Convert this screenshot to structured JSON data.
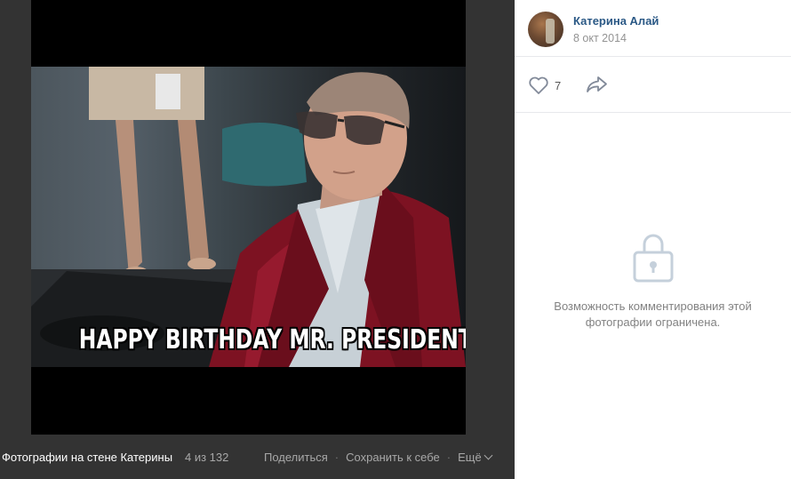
{
  "photo": {
    "caption": "HAPPY BIRTHDAY MR. PRESIDENT"
  },
  "footer": {
    "album": "Фотографии на стене Катерины",
    "counter": "4 из 132",
    "share": "Поделиться",
    "save": "Сохранить к себе",
    "more": "Ещё"
  },
  "author": {
    "name": "Катерина Алай",
    "date": "8 окт 2014"
  },
  "likes": {
    "count": "7"
  },
  "comments": {
    "line1": "Возможность комментирования этой",
    "line2": "фотографии ограничена."
  },
  "colors": {
    "link": "#2a5885",
    "muted": "#939393",
    "background_dark": "#333333"
  },
  "icons": [
    "heart-icon",
    "share-arrow-icon",
    "lock-icon",
    "chevron-down-icon"
  ]
}
